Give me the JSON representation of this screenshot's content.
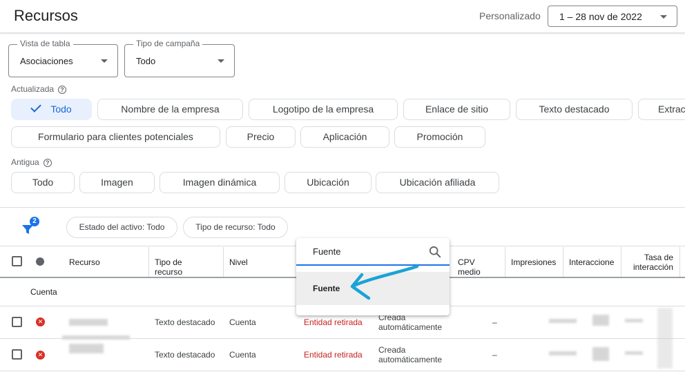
{
  "header": {
    "title": "Recursos",
    "date_label": "Personalizado",
    "date_range": "1 – 28 nov de 2022"
  },
  "filters": {
    "table_view": {
      "label": "Vista de tabla",
      "value": "Asociaciones"
    },
    "campaign_type": {
      "label": "Tipo de campaña",
      "value": "Todo"
    }
  },
  "updated": {
    "label": "Actualizada",
    "chips": [
      "Todo",
      "Nombre de la empresa",
      "Logotipo de la empresa",
      "Enlace de sitio",
      "Texto destacado",
      "Extrac",
      "Formulario para clientes potenciales",
      "Precio",
      "Aplicación",
      "Promoción"
    ]
  },
  "legacy": {
    "label": "Antigua",
    "chips": [
      "Todo",
      "Imagen",
      "Imagen dinámica",
      "Ubicación",
      "Ubicación afiliada"
    ]
  },
  "filter_bar": {
    "badge": "2",
    "chips": [
      "Estado del activo: Todo",
      "Tipo de recurso: Todo"
    ]
  },
  "table": {
    "headers": {
      "recurso": "Recurso",
      "tipo": "Tipo de recurso",
      "nivel": "Nivel",
      "cpv": "CPV medio",
      "impresiones": "Impresiones",
      "interaccion": "Interaccione",
      "tasa_1": "Tasa de",
      "tasa_2": "interacción"
    },
    "group_label": "Cuenta",
    "rows": [
      {
        "tipo": "Texto destacado",
        "nivel": "Cuenta",
        "estado": "Entidad retirada",
        "origen_1": "Creada",
        "origen_2": "automáticamente",
        "cpv": "–"
      },
      {
        "tipo": "Texto destacado",
        "nivel": "Cuenta",
        "estado": "Entidad retirada",
        "origen_1": "Creada",
        "origen_2": "automáticamente",
        "cpv": "–"
      }
    ]
  },
  "column_popup": {
    "search_value": "Fuente",
    "option": "Fuente"
  },
  "colors": {
    "accent": "#1a73e8",
    "selected_chip_bg": "#e8f0fe",
    "error": "#d93025",
    "annotation_arrow": "#1ba3d6"
  },
  "icons": [
    "chevron-down-icon",
    "help-icon",
    "checkmark-icon",
    "filter-icon",
    "search-icon",
    "error-icon",
    "status-dot-icon"
  ]
}
